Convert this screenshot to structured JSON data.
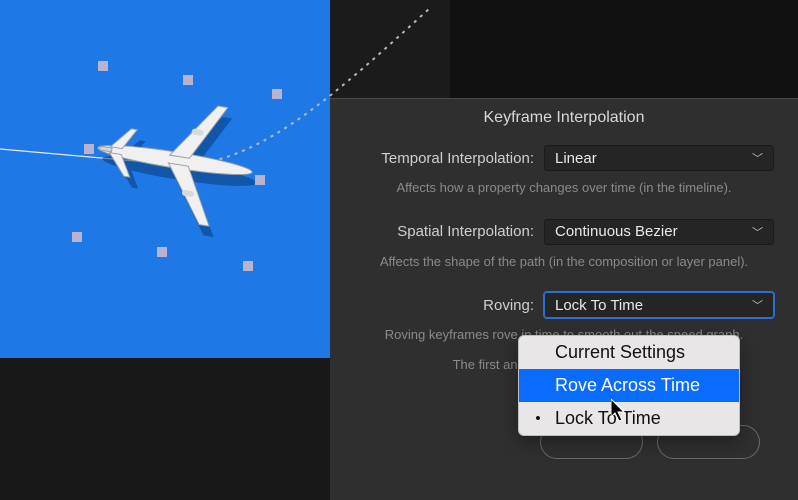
{
  "dialog": {
    "title": "Keyframe Interpolation",
    "temporal": {
      "label": "Temporal Interpolation:",
      "value": "Linear",
      "hint": "Affects how a property changes over time (in the timeline)."
    },
    "spatial": {
      "label": "Spatial Interpolation:",
      "value": "Continuous Bezier",
      "hint": "Affects the shape of the path (in the composition or layer panel)."
    },
    "roving": {
      "label": "Roving:",
      "value": "Lock To Time",
      "hint1": "Roving keyframes rove in time to smooth out the speed graph.",
      "hint2": "The first and last keyframes can't rove.",
      "menu": {
        "items": [
          {
            "label": "Current Settings",
            "selected": false
          },
          {
            "label": "Rove Across Time",
            "selected": false,
            "highlighted": true
          },
          {
            "label": "Lock To Time",
            "selected": true
          }
        ]
      }
    }
  },
  "canvas": {
    "layer_color": "#1e78e6"
  }
}
